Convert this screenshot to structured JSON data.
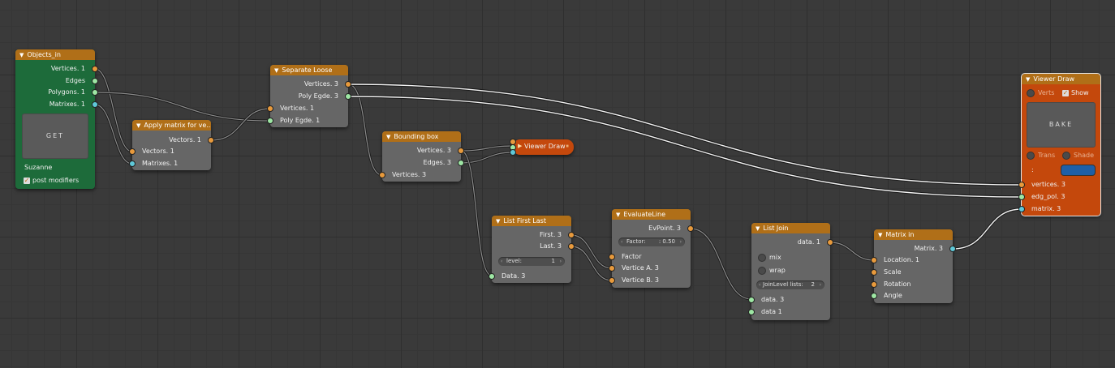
{
  "objects_in": {
    "title": "Objects_in",
    "outputs": [
      "Vertices. 1",
      "Edges",
      "Polygons. 1",
      "Matrixes. 1"
    ],
    "get_label": "GET",
    "object_name": "Suzanne",
    "post_modifiers": "post modifiers"
  },
  "apply_matrix": {
    "title": "Apply matrix for ve...",
    "output": "Vectors. 1",
    "inputs": [
      "Vectors. 1",
      "Matrixes. 1"
    ]
  },
  "separate_loose": {
    "title": "Separate Loose",
    "outputs": [
      "Vertices. 3",
      "Poly Egde. 3"
    ],
    "inputs": [
      "Vertices. 1",
      "Poly Egde. 1"
    ]
  },
  "bounding_box": {
    "title": "Bounding box",
    "outputs": [
      "Vertices. 3",
      "Edges. 3"
    ],
    "input": "Vertices. 3"
  },
  "viewer_draw_small": {
    "title": "Viewer Draw"
  },
  "list_first_last": {
    "title": "List First Last",
    "outputs": [
      "First. 3",
      "Last. 3"
    ],
    "level_label": "level:",
    "level_value": "1",
    "input": "Data. 3"
  },
  "evaluate_line": {
    "title": "EvaluateLine",
    "output": "EvPoint. 3",
    "factor_label": "Factor:",
    "factor_value": ": 0.50",
    "inputs": [
      "Factor",
      "Vertice A. 3",
      "Vertice B. 3"
    ]
  },
  "list_join": {
    "title": "List Join",
    "output": "data. 1",
    "mix_label": "mix",
    "wrap_label": "wrap",
    "joinlevel_label": "JoinLevel lists:",
    "joinlevel_value": "2",
    "inputs": [
      "data. 3",
      "data 1"
    ]
  },
  "matrix_in": {
    "title": "Matrix in",
    "output": "Matrix. 3",
    "inputs": [
      "Location. 1",
      "Scale",
      "Rotation",
      "Angle"
    ]
  },
  "viewer_draw": {
    "title": "Viewer Draw",
    "verts_label": "Verts",
    "show_label": "Show",
    "bake_label": "BAKE",
    "trans_label": "Trans",
    "shade_label": "Shade",
    "color_label": ":",
    "inputs": [
      "vertices. 3",
      "edg_pol. 3",
      "matrix. 3"
    ],
    "color_swatch": "#1f5fa6"
  },
  "colors": {
    "header_orange": "#b06f18",
    "objects_green": "#1d6b3a",
    "viewer_red": "#c4480c",
    "socket_vertices": "#e89a3c",
    "socket_edges": "#9ee7a4",
    "socket_matrix": "#5fc8d8"
  }
}
